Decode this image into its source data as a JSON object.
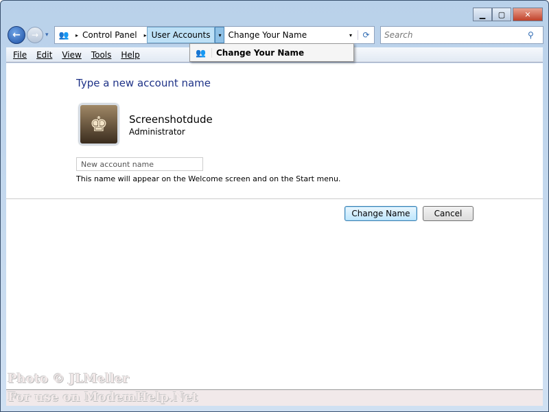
{
  "window": {
    "minimize": "▁",
    "maximize": "▢",
    "close": "✕"
  },
  "nav": {
    "back": "←",
    "forward": "→",
    "dropdown": "▾"
  },
  "address": {
    "crumbs": [
      "Control Panel",
      "User Accounts"
    ],
    "current": "Change Your Name",
    "separator": "▸",
    "dropdown": "▾",
    "refresh": "⟳"
  },
  "search": {
    "placeholder": "Search",
    "icon": "⚲"
  },
  "menu": [
    "File",
    "Edit",
    "View",
    "Tools",
    "Help"
  ],
  "popup": {
    "item": "Change Your Name"
  },
  "main": {
    "heading": "Type a new account name",
    "user_name": "Screenshotdude",
    "user_role": "Administrator",
    "input_placeholder": "New account name",
    "hint": "This name will appear on the Welcome screen and on the Start menu.",
    "change_button": "Change Name",
    "cancel_button": "Cancel"
  },
  "watermark": {
    "line1": "Photo © JLMeller",
    "line2": "For use on ModemHelp.Net"
  }
}
